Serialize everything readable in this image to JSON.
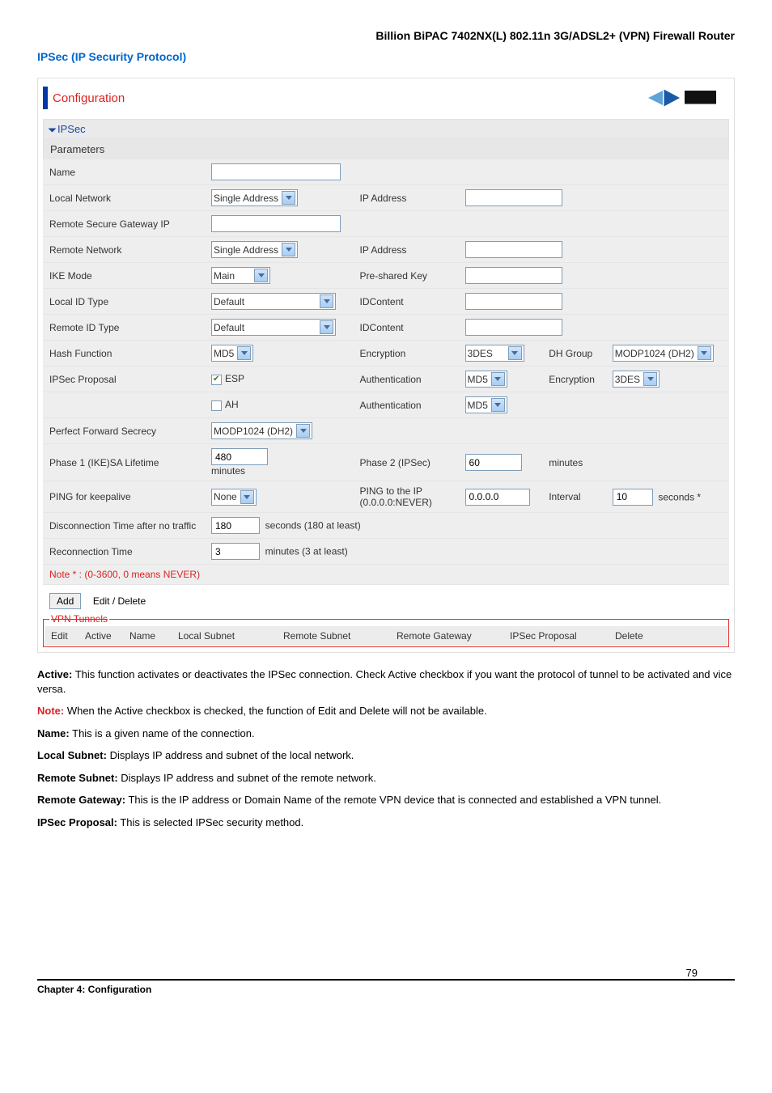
{
  "doc": {
    "title": "Billion BiPAC 7402NX(L) 802.11n 3G/ADSL2+ (VPN) Firewall Router",
    "section_title": "IPSec (IP Security Protocol)",
    "chapter": "Chapter 4: Configuration",
    "page_number": "79"
  },
  "config": {
    "panel_title": "Configuration",
    "section": "IPSec",
    "parameters_label": "Parameters",
    "rows": {
      "name_label": "Name",
      "local_network_label": "Local Network",
      "local_network_select": "Single Address",
      "ip_address_label": "IP Address",
      "remote_secure_gw_label": "Remote Secure Gateway IP",
      "remote_network_label": "Remote Network",
      "remote_network_select": "Single Address",
      "ike_mode_label": "IKE Mode",
      "ike_mode_select": "Main",
      "preshared_label": "Pre-shared Key",
      "local_id_type_label": "Local ID Type",
      "local_id_type_select": "Default",
      "idcontent_label": "IDContent",
      "remote_id_type_label": "Remote ID Type",
      "remote_id_type_select": "Default",
      "hash_label": "Hash Function",
      "hash_select": "MD5",
      "encryption_label": "Encryption",
      "encryption_select": "3DES",
      "dh_group_label": "DH Group",
      "dh_group_select": "MODP1024 (DH2)",
      "ipsec_proposal_label": "IPSec Proposal",
      "esp_label": "ESP",
      "auth_label": "Authentication",
      "auth_esp_select": "MD5",
      "auth_esp_enc_label": "Encryption",
      "auth_esp_enc_select": "3DES",
      "ah_label": "AH",
      "auth_ah_select": "MD5",
      "pfs_label": "Perfect Forward Secrecy",
      "pfs_select": "MODP1024 (DH2)",
      "phase1_label": "Phase 1 (IKE)SA Lifetime",
      "phase1_value": "480",
      "phase1_unit": "minutes",
      "phase2_label": "Phase 2 (IPSec)",
      "phase2_value": "60",
      "phase2_unit": "minutes",
      "ping_label": "PING for keepalive",
      "ping_select": "None",
      "ping_ip_label": "PING to the IP",
      "ping_ip_hint": "(0.0.0.0:NEVER)",
      "ping_ip_value": "0.0.0.0",
      "interval_label": "Interval",
      "interval_value": "10",
      "interval_unit": "seconds *",
      "disc_label": "Disconnection Time after no traffic",
      "disc_value": "180",
      "disc_unit": "seconds (180 at least)",
      "recon_label": "Reconnection Time",
      "recon_value": "3",
      "recon_unit": "minutes (3 at least)",
      "note": "Note * : (0-3600, 0 means NEVER)",
      "add_btn": "Add",
      "edit_btn": "Edit / Delete"
    },
    "vpn": {
      "title": "VPN Tunnels",
      "headers": [
        "Edit",
        "Active",
        "Name",
        "Local Subnet",
        "Remote Subnet",
        "Remote Gateway",
        "IPSec Proposal",
        "Delete"
      ]
    }
  },
  "descriptions": {
    "active_lbl": "Active:",
    "active_txt": " This function activates or deactivates the IPSec connection.   Check Active checkbox if you want the protocol of tunnel to be activated and vice versa.",
    "note_lbl": "Note:",
    "note_txt": " When the Active checkbox is checked, the function of Edit and Delete will not be available.",
    "name_lbl": "Name:",
    "name_txt": " This is a given name of the connection.",
    "ls_lbl": "Local Subnet:",
    "ls_txt": " Displays IP address and subnet of the local network.",
    "rs_lbl": "Remote Subnet:",
    "rs_txt": " Displays IP address and subnet of the remote network.",
    "rg_lbl": "Remote Gateway:",
    "rg_txt": " This is the IP address or Domain Name of the remote VPN device that is connected and established a VPN tunnel.",
    "ip_lbl": "IPSec Proposal:",
    "ip_txt": " This is selected IPSec security method."
  }
}
